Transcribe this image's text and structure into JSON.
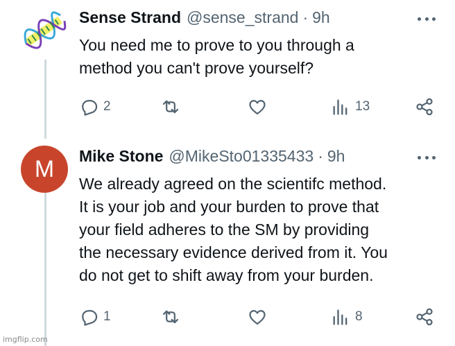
{
  "tweets": [
    {
      "name": "Sense Strand",
      "handle": "@sense_strand",
      "separator": "·",
      "time": "9h",
      "lines": [
        "You need me to prove to you through a",
        "method you can't prove yourself?"
      ],
      "reply_count": "2",
      "retweet_count": "",
      "like_count": "",
      "view_count": "13"
    },
    {
      "name": "Mike Stone",
      "handle": "@MikeSto01335433",
      "separator": "·",
      "time": "9h",
      "avatar_letter": "M",
      "avatar_color": "#c8452c",
      "lines": [
        "We already agreed on the scientifc method.",
        "It is your job and your burden to prove that",
        "your field adheres to the SM by providing",
        "the necessary evidence derived from it. You",
        "do not get to shift away from your burden."
      ],
      "reply_count": "1",
      "retweet_count": "",
      "like_count": "",
      "view_count": "8"
    }
  ],
  "icons": {
    "reply": "reply-icon",
    "retweet": "retweet-icon",
    "like": "heart-icon",
    "views": "views-icon",
    "share": "share-icon",
    "more": "more-icon"
  },
  "colors": {
    "text": "#0f1419",
    "secondary": "#536471",
    "thread_line": "#cfd9de"
  },
  "watermark": "imgflip.com"
}
